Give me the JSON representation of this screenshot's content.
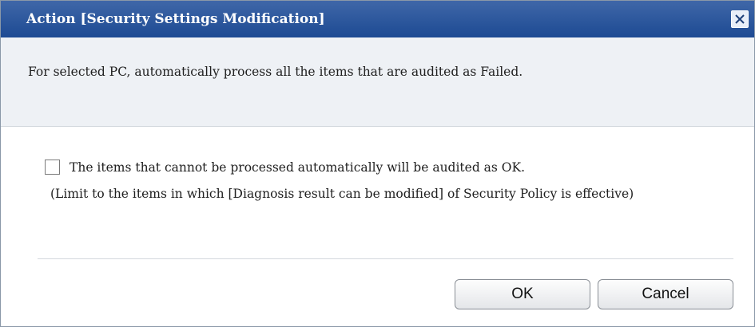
{
  "dialog": {
    "title": "Action [Security Settings Modification]",
    "close_icon": "close-icon",
    "description": "For selected PC, automatically process all the items that are audited as Failed.",
    "option": {
      "checked": false,
      "label": "The items that cannot be processed automatically will be audited as OK.",
      "note": "(Limit to the items in which [Diagnosis result can be modified] of Security Policy is effective)"
    },
    "buttons": {
      "ok_label": "OK",
      "cancel_label": "Cancel"
    }
  },
  "colors": {
    "titlebar": "#2a5399",
    "title_text": "#ffffff",
    "description_bg": "#eef1f5",
    "button_border": "#8a8f96"
  }
}
